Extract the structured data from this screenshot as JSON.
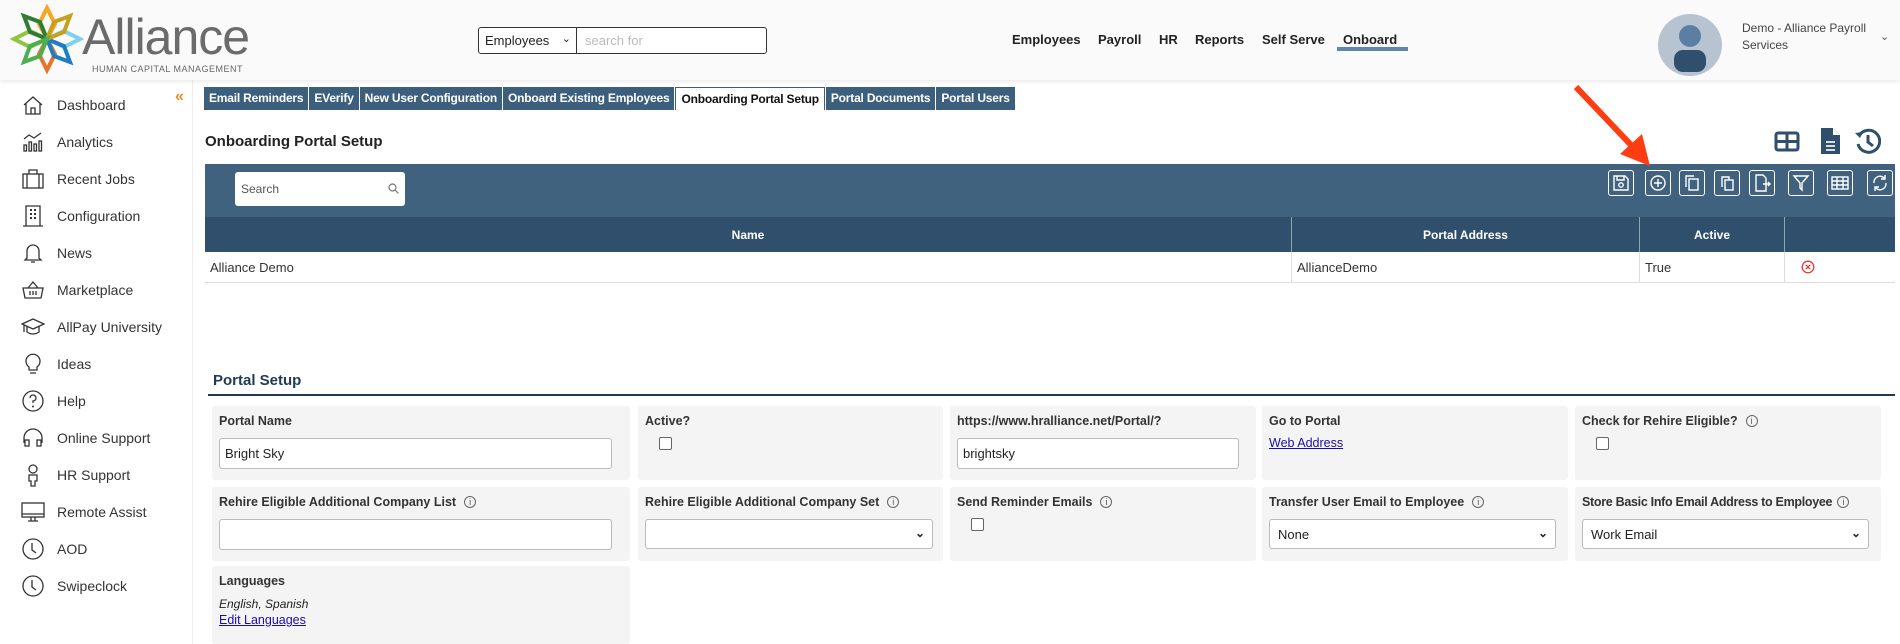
{
  "brand": {
    "name": "Alliance",
    "tagline": "HUMAN CAPITAL MANAGEMENT"
  },
  "global_search": {
    "scope": "Employees",
    "placeholder": "search for"
  },
  "nav": [
    {
      "label": "Employees"
    },
    {
      "label": "Payroll"
    },
    {
      "label": "HR"
    },
    {
      "label": "Reports"
    },
    {
      "label": "Self Serve"
    },
    {
      "label": "Onboard",
      "active": true
    }
  ],
  "user": {
    "name": "Demo - Alliance Payroll Services"
  },
  "sidebar": {
    "items": [
      {
        "label": "Dashboard",
        "icon": "home-icon"
      },
      {
        "label": "Analytics",
        "icon": "analytics-icon"
      },
      {
        "label": "Recent Jobs",
        "icon": "briefcase-icon"
      },
      {
        "label": "Configuration",
        "icon": "building-icon"
      },
      {
        "label": "News",
        "icon": "bell-icon"
      },
      {
        "label": "Marketplace",
        "icon": "basket-icon"
      },
      {
        "label": "AllPay University",
        "icon": "graduation-cap-icon"
      },
      {
        "label": "Ideas",
        "icon": "lightbulb-icon"
      },
      {
        "label": "Help",
        "icon": "help-icon"
      },
      {
        "label": "Online Support",
        "icon": "headphones-icon"
      },
      {
        "label": "HR Support",
        "icon": "person-icon"
      },
      {
        "label": "Remote Assist",
        "icon": "monitor-icon"
      },
      {
        "label": "AOD",
        "icon": "clock-icon"
      },
      {
        "label": "Swipeclock",
        "icon": "clock-icon"
      }
    ],
    "collapse": "«"
  },
  "tabs": [
    {
      "label": "Email Reminders"
    },
    {
      "label": "EVerify"
    },
    {
      "label": "New User Configuration"
    },
    {
      "label": "Onboard Existing Employees"
    },
    {
      "label": "Onboarding Portal Setup",
      "active": true
    },
    {
      "label": "Portal Documents"
    },
    {
      "label": "Portal Users"
    }
  ],
  "page": {
    "title": "Onboarding Portal Setup"
  },
  "grid": {
    "search_placeholder": "Search",
    "toolbar": [
      "save-icon",
      "add-icon",
      "copy-icon",
      "paste-icon",
      "export-icon",
      "filter-icon",
      "columns-icon",
      "refresh-icon"
    ],
    "columns": [
      "Name",
      "Portal Address",
      "Active",
      ""
    ],
    "rows": [
      {
        "name": "Alliance Demo",
        "portal_address": "AllianceDemo",
        "active": "True"
      }
    ]
  },
  "portal_setup": {
    "title": "Portal Setup",
    "portal_name": {
      "label": "Portal Name",
      "value": "Bright Sky"
    },
    "active": {
      "label": "Active?",
      "checked": false
    },
    "portal_url": {
      "label": "https://www.hralliance.net/Portal/?",
      "value": "brightsky"
    },
    "go_to_portal": {
      "label": "Go to Portal",
      "link": "Web Address"
    },
    "check_rehire": {
      "label": "Check for Rehire Eligible?",
      "checked": false
    },
    "rehire_list": {
      "label": "Rehire Eligible Additional Company List",
      "value": ""
    },
    "rehire_set": {
      "label": "Rehire Eligible Additional Company Set",
      "value": ""
    },
    "send_reminder": {
      "label": "Send Reminder Emails",
      "checked": false
    },
    "transfer_email": {
      "label": "Transfer User Email to Employee",
      "value": "None"
    },
    "store_email": {
      "label": "Store Basic Info Email Address to Employee",
      "value": "Work Email"
    },
    "languages": {
      "label": "Languages",
      "value": "English, Spanish",
      "link": "Edit Languages"
    }
  },
  "colors": {
    "tab": "#3d5f7e",
    "band": "#41627f",
    "table_header": "#2f4f6d",
    "accent": "#f08a24",
    "arrow": "#ff3d12"
  }
}
